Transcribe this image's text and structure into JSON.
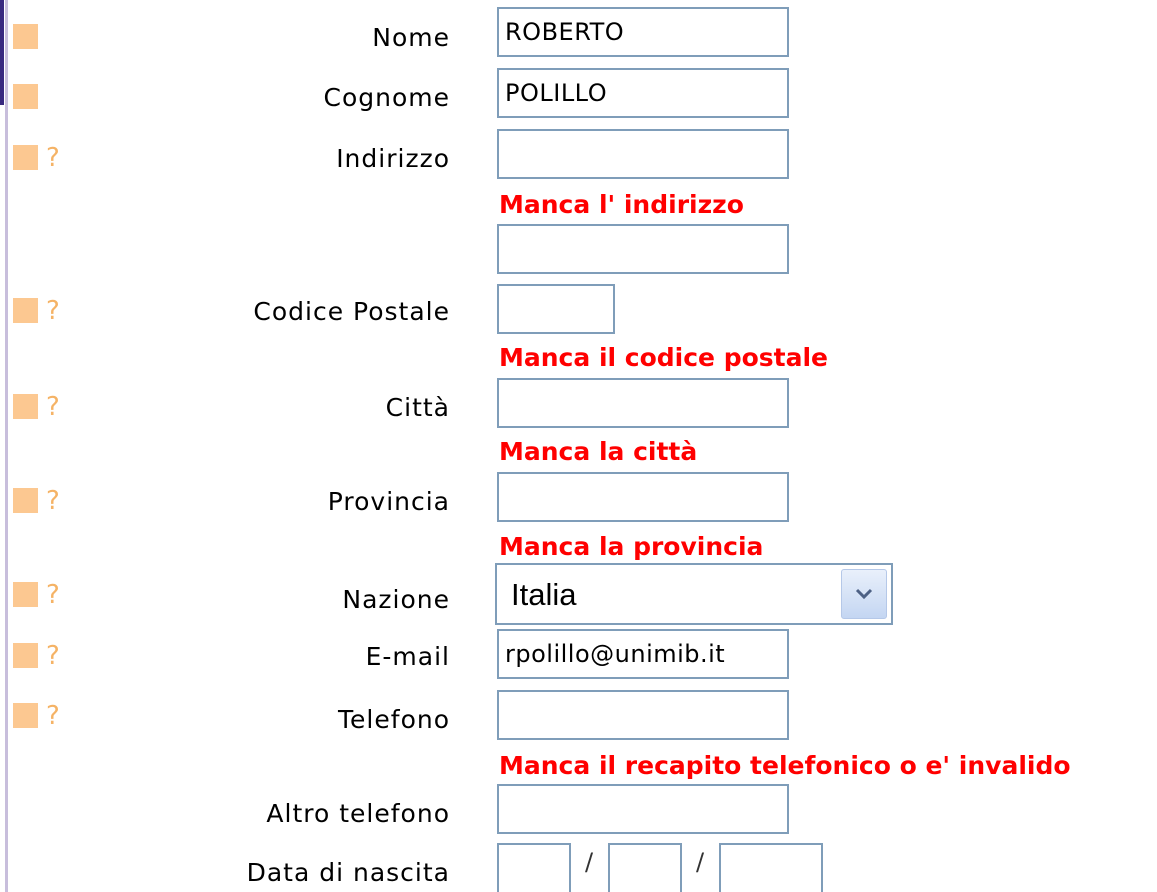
{
  "colors": {
    "marker": "#fcc891",
    "help": "#f5b366",
    "error": "#ff0000",
    "field_border": "#7f9db9"
  },
  "icons": {
    "marker": "status-square",
    "help": "help-question-icon",
    "dropdown": "chevron-down-icon"
  },
  "help_symbol": "?",
  "form": {
    "nome": {
      "label": "Nome",
      "value": "ROBERTO"
    },
    "cognome": {
      "label": "Cognome",
      "value": "POLILLO"
    },
    "indirizzo": {
      "label": "Indirizzo",
      "value": "",
      "value2": "",
      "error": "Manca l' indirizzo"
    },
    "cap": {
      "label": "Codice Postale",
      "value": "",
      "error": "Manca il codice postale"
    },
    "citta": {
      "label": "Città",
      "value": "",
      "error": "Manca la città"
    },
    "provincia": {
      "label": "Provincia",
      "value": "",
      "error": "Manca la provincia"
    },
    "nazione": {
      "label": "Nazione",
      "value": "Italia"
    },
    "email": {
      "label": "E-mail",
      "value": "rpolillo@unimib.it"
    },
    "telefono": {
      "label": "Telefono",
      "value": "",
      "error": "Manca il recapito telefonico o e' invalido"
    },
    "altro_telefono": {
      "label": "Altro telefono",
      "value": ""
    },
    "data_nascita": {
      "label": "Data di nascita",
      "day": "",
      "month": "",
      "year": "",
      "separator": "/"
    }
  }
}
